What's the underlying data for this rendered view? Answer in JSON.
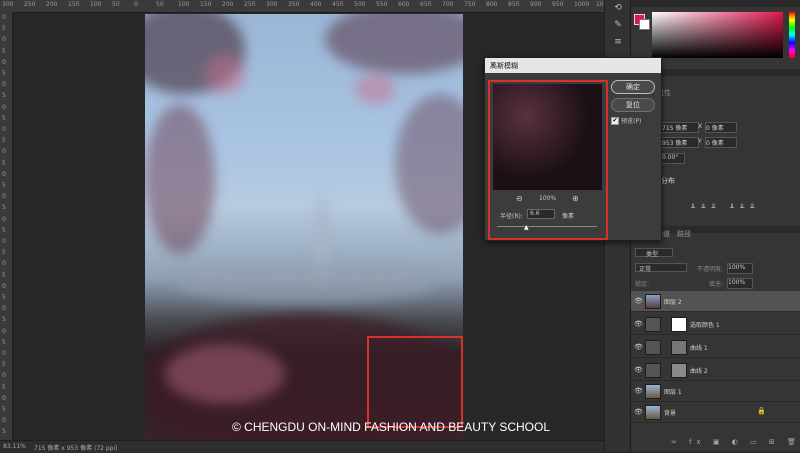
{
  "ruler_top_ticks": [
    "300",
    "250",
    "200",
    "150",
    "100",
    "50",
    "0",
    "50",
    "100",
    "150",
    "200",
    "250",
    "300",
    "350",
    "400",
    "450",
    "500",
    "550",
    "600",
    "650",
    "700",
    "750",
    "800",
    "850",
    "900",
    "950",
    "1000",
    "1050"
  ],
  "ruler_left_ticks": [
    "0",
    "5",
    "0",
    "5",
    "0",
    "5",
    "0",
    "5",
    "0",
    "5",
    "0",
    "5",
    "0",
    "5",
    "0",
    "5",
    "0",
    "5",
    "0",
    "5",
    "0",
    "5",
    "0",
    "5",
    "0",
    "5",
    "0",
    "5",
    "0",
    "5",
    "0",
    "5",
    "0",
    "5",
    "0",
    "5",
    "0",
    "5"
  ],
  "status": {
    "zoom": "83.11%",
    "doc_info": "715 像素 x 953 像素 (72 ppi)"
  },
  "dialog": {
    "title": "高斯模糊",
    "ok_label": "确定",
    "reset_label": "复位",
    "preview_label": "预览(P)",
    "preview_checked": true,
    "zoom_level": "100%",
    "radius_label": "半径(R):",
    "radius_value": "6.6",
    "radius_unit": "像素"
  },
  "properties": {
    "title": "属性",
    "w_value": "715 像素",
    "x_label": "X",
    "x_value": "0 像素",
    "h_value": "953 像素",
    "y_label": "Y",
    "y_value": "0 像素",
    "angle_value": "0.00°",
    "align_label": "分布"
  },
  "layers_panel": {
    "tabs": [
      "图层",
      "通道",
      "路径"
    ],
    "filter_placeholder": "类型",
    "blend_mode": "正常",
    "opacity_label": "不透明度:",
    "opacity_value": "100%",
    "lock_label": "锁定:",
    "fill_label": "填充:",
    "fill_value": "100%",
    "layers": [
      {
        "name": "图层 2",
        "selected": true
      },
      {
        "name": "选取颜色 1",
        "selected": false
      },
      {
        "name": "曲线 1",
        "selected": false
      },
      {
        "name": "曲线 2",
        "selected": false
      },
      {
        "name": "图层 1",
        "selected": false
      },
      {
        "name": "背景",
        "selected": false
      }
    ],
    "bottom_icons": [
      "link-icon",
      "fx-icon",
      "mask-icon",
      "adjustment-icon",
      "group-icon",
      "new-layer-icon",
      "trash-icon"
    ]
  },
  "colors": {
    "foreground": "#e0174f",
    "accent_red": "#d6322c"
  },
  "watermark": "© CHENGDU ON-MIND FASHION AND BEAUTY SCHOOL"
}
